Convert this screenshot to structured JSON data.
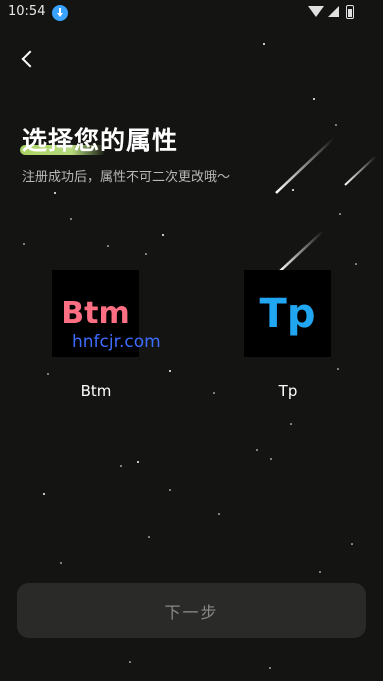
{
  "status_bar": {
    "time": "10:54"
  },
  "header": {
    "title": "选择您的属性",
    "subtitle": "注册成功后，属性不可二次更改哦～"
  },
  "options": [
    {
      "logo_text": "Btm",
      "label": "Btm",
      "logo_color": "#ff6f84"
    },
    {
      "logo_text": "Tp",
      "label": "Tp",
      "logo_color": "#21a6f2"
    }
  ],
  "watermark": "hnfcjr.com",
  "footer": {
    "next_label": "下一步"
  },
  "colors": {
    "background": "#141512",
    "title_highlight": "#c8f08a",
    "button_bg": "#2a2b29"
  }
}
